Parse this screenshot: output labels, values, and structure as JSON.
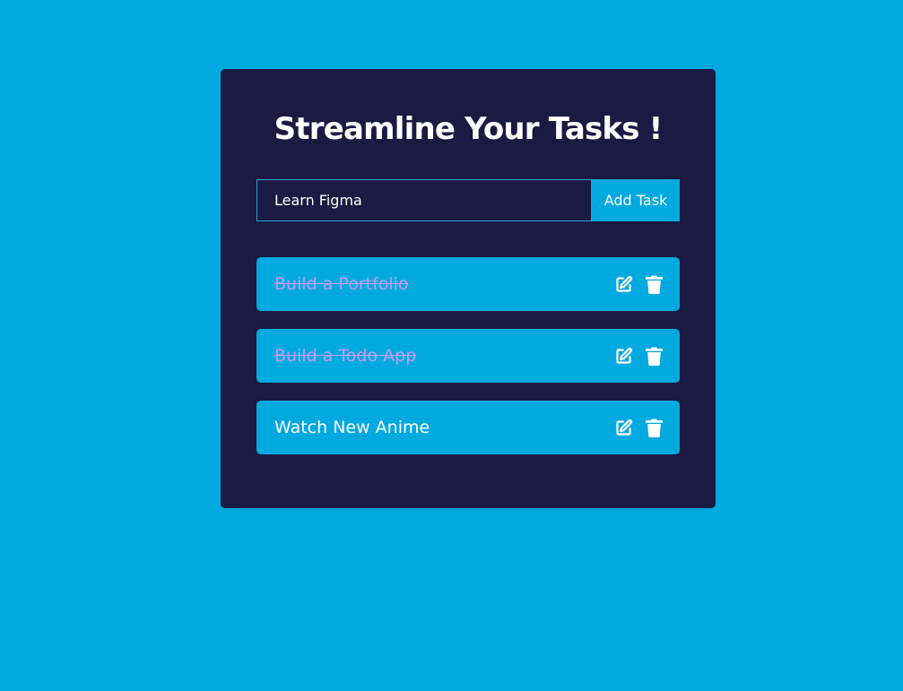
{
  "app": {
    "title": "Streamline Your Tasks !"
  },
  "form": {
    "input_value": "Learn Figma",
    "add_label": "Add Task"
  },
  "tasks": [
    {
      "text": "Build a Portfolio",
      "completed": true
    },
    {
      "text": "Build a Todo App",
      "completed": true
    },
    {
      "text": "Watch New Anime",
      "completed": false
    }
  ],
  "icons": {
    "edit": "edit-icon",
    "delete": "trash-icon"
  },
  "colors": {
    "background": "#00a9e0",
    "card": "#1b1a42",
    "completed_text": "#c29df0"
  }
}
